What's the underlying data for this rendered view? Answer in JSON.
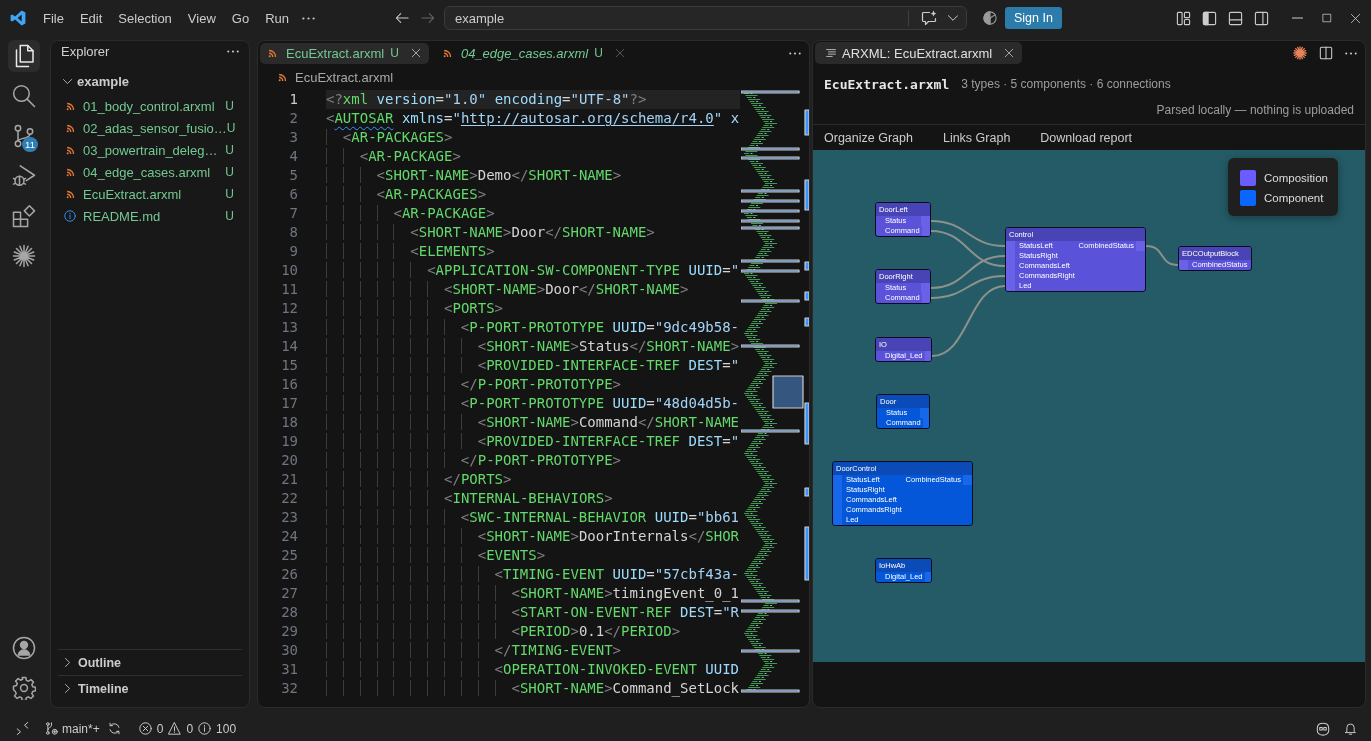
{
  "titlebar": {
    "menu": [
      "File",
      "Edit",
      "Selection",
      "View",
      "Go",
      "Run"
    ],
    "back": {
      "disabled": false
    },
    "forward": {
      "disabled": true
    },
    "command_center": {
      "label": "example"
    },
    "sign_in": "Sign In",
    "layout_buttons": [
      {
        "kind": "customize",
        "on": false
      },
      {
        "kind": "sidebar",
        "on": true
      },
      {
        "kind": "panel",
        "on": false
      },
      {
        "kind": "secondary",
        "on": false
      }
    ]
  },
  "activity_bar": {
    "items": [
      {
        "kind": "explorer",
        "selected": true
      },
      {
        "kind": "search",
        "selected": false
      },
      {
        "kind": "source-control",
        "selected": false,
        "badge": "11"
      },
      {
        "kind": "run-debug",
        "selected": false
      },
      {
        "kind": "extensions",
        "selected": false
      },
      {
        "kind": "sparkle",
        "selected": false
      }
    ],
    "bottom": [
      {
        "kind": "account"
      },
      {
        "kind": "settings"
      }
    ]
  },
  "explorer": {
    "title": "Explorer",
    "folder": {
      "label": "example",
      "expanded": true,
      "children": [
        {
          "label": "01_body_control.arxml",
          "kind": "xml",
          "status": "U"
        },
        {
          "label": "02_adas_sensor_fusio…",
          "kind": "xml",
          "status": "U"
        },
        {
          "label": "03_powertrain_deleg…",
          "kind": "xml",
          "status": "U"
        },
        {
          "label": "04_edge_cases.arxml",
          "kind": "xml",
          "status": "U"
        },
        {
          "label": "EcuExtract.arxml",
          "kind": "xml",
          "status": "U"
        },
        {
          "label": "README.md",
          "kind": "markdown",
          "status": "U"
        }
      ]
    },
    "sections": [
      {
        "label": "Outline",
        "expanded": false
      },
      {
        "label": "Timeline",
        "expanded": false
      }
    ]
  },
  "editor": {
    "tabs": [
      {
        "label": "EcuExtract.arxml",
        "kind": "xml",
        "status": "U",
        "selected": true,
        "preview": false
      },
      {
        "label": "04_edge_cases.arxml",
        "kind": "xml",
        "status": "U",
        "selected": false,
        "preview": true
      }
    ],
    "breadcrumb": [
      {
        "label": "EcuExtract.arxml",
        "kind": "xml"
      }
    ],
    "lines": [
      {
        "number": "1",
        "text": "<?xml version=\"1.0\" encoding=\"UTF-8\"?>",
        "current": true,
        "warning": false,
        "link": false
      },
      {
        "number": "2",
        "text": "<AUTOSAR xmlns=\"http://autosar.org/schema/r4.0\" x",
        "current": false,
        "warning": true,
        "link": true
      },
      {
        "number": "3",
        "text": "  <AR-PACKAGES>",
        "current": false,
        "warning": false,
        "link": false
      },
      {
        "number": "4",
        "text": "    <AR-PACKAGE>",
        "current": false,
        "warning": false,
        "link": false
      },
      {
        "number": "5",
        "text": "      <SHORT-NAME>Demo</SHORT-NAME>",
        "current": false,
        "warning": false,
        "link": false
      },
      {
        "number": "6",
        "text": "      <AR-PACKAGES>",
        "current": false,
        "warning": false,
        "link": false
      },
      {
        "number": "7",
        "text": "        <AR-PACKAGE>",
        "current": false,
        "warning": false,
        "link": false
      },
      {
        "number": "8",
        "text": "          <SHORT-NAME>Door</SHORT-NAME>",
        "current": false,
        "warning": false,
        "link": false
      },
      {
        "number": "9",
        "text": "          <ELEMENTS>",
        "current": false,
        "warning": false,
        "link": false
      },
      {
        "number": "10",
        "text": "            <APPLICATION-SW-COMPONENT-TYPE UUID=\"",
        "current": false,
        "warning": false,
        "link": false
      },
      {
        "number": "11",
        "text": "              <SHORT-NAME>Door</SHORT-NAME>",
        "current": false,
        "warning": false,
        "link": false
      },
      {
        "number": "12",
        "text": "              <PORTS>",
        "current": false,
        "warning": false,
        "link": false
      },
      {
        "number": "13",
        "text": "                <P-PORT-PROTOTYPE UUID=\"9dc49b58-",
        "current": false,
        "warning": false,
        "link": false
      },
      {
        "number": "14",
        "text": "                  <SHORT-NAME>Status</SHORT-NAME>",
        "current": false,
        "warning": false,
        "link": false
      },
      {
        "number": "15",
        "text": "                  <PROVIDED-INTERFACE-TREF DEST=\"",
        "current": false,
        "warning": false,
        "link": false
      },
      {
        "number": "16",
        "text": "                </P-PORT-PROTOTYPE>",
        "current": false,
        "warning": false,
        "link": false
      },
      {
        "number": "17",
        "text": "                <P-PORT-PROTOTYPE UUID=\"48d04d5b-",
        "current": false,
        "warning": false,
        "link": false
      },
      {
        "number": "18",
        "text": "                  <SHORT-NAME>Command</SHORT-NAME",
        "current": false,
        "warning": false,
        "link": false
      },
      {
        "number": "19",
        "text": "                  <PROVIDED-INTERFACE-TREF DEST=\"",
        "current": false,
        "warning": false,
        "link": false
      },
      {
        "number": "20",
        "text": "                </P-PORT-PROTOTYPE>",
        "current": false,
        "warning": false,
        "link": false
      },
      {
        "number": "21",
        "text": "              </PORTS>",
        "current": false,
        "warning": false,
        "link": false
      },
      {
        "number": "22",
        "text": "              <INTERNAL-BEHAVIORS>",
        "current": false,
        "warning": false,
        "link": false
      },
      {
        "number": "23",
        "text": "                <SWC-INTERNAL-BEHAVIOR UUID=\"bb61",
        "current": false,
        "warning": false,
        "link": false
      },
      {
        "number": "24",
        "text": "                  <SHORT-NAME>DoorInternals</SHOR",
        "current": false,
        "warning": false,
        "link": false
      },
      {
        "number": "25",
        "text": "                  <EVENTS>",
        "current": false,
        "warning": false,
        "link": false
      },
      {
        "number": "26",
        "text": "                    <TIMING-EVENT UUID=\"57cbf43a-",
        "current": false,
        "warning": false,
        "link": false
      },
      {
        "number": "27",
        "text": "                      <SHORT-NAME>timingEvent_0_1",
        "current": false,
        "warning": false,
        "link": false
      },
      {
        "number": "28",
        "text": "                      <START-ON-EVENT-REF DEST=\"R",
        "current": false,
        "warning": false,
        "link": false
      },
      {
        "number": "29",
        "text": "                      <PERIOD>0.1</PERIOD>",
        "current": false,
        "warning": false,
        "link": false
      },
      {
        "number": "30",
        "text": "                    </TIMING-EVENT>",
        "current": false,
        "warning": false,
        "link": false
      },
      {
        "number": "31",
        "text": "                    <OPERATION-INVOKED-EVENT UUID",
        "current": false,
        "warning": false,
        "link": false
      },
      {
        "number": "32",
        "text": "                      <SHORT-NAME>Command_SetLock",
        "current": false,
        "warning": false,
        "link": false
      }
    ]
  },
  "viewer": {
    "tab": {
      "label": "ARXML: EcuExtract.arxml",
      "selected": true
    },
    "title": "EcuExtract.arxml",
    "summary": "3 types · 5 components · 6 connections",
    "note": "Parsed locally — nothing is uploaded",
    "actions": [
      "Organize Graph",
      "Links Graph",
      "Download report"
    ],
    "graph": {
      "legend": [
        {
          "label": "Composition",
          "color": "#6b5cff"
        },
        {
          "label": "Component",
          "color": "#0a66ff"
        }
      ],
      "nodes": [
        {
          "title": "DoorLeft",
          "kind": "composition",
          "outputs": [
            "Status",
            "Command"
          ]
        },
        {
          "title": "DoorRight",
          "kind": "composition",
          "outputs": [
            "Status",
            "Command"
          ]
        },
        {
          "title": "Control",
          "kind": "composition",
          "inputs": [
            "StatusLeft",
            "StatusRight",
            "CommandsLeft",
            "CommandsRight",
            "Led"
          ],
          "outputs": [
            "CombinedStatus"
          ]
        },
        {
          "title": "EDCOutputBlock",
          "kind": "composition",
          "inputs": [
            "CombinedStatus"
          ]
        },
        {
          "title": "IO",
          "kind": "composition",
          "outputs": [
            "Digital_Led"
          ]
        },
        {
          "title": "Door",
          "kind": "component",
          "outputs": [
            "Status",
            "Command"
          ]
        },
        {
          "title": "DoorControl",
          "kind": "component",
          "inputs": [
            "StatusLeft",
            "StatusRight",
            "CommandsLeft",
            "CommandsRight",
            "Led"
          ],
          "outputs": [
            "CombinedStatus"
          ]
        },
        {
          "title": "IoHwAb",
          "kind": "component",
          "outputs": [
            "Digital_Led"
          ]
        }
      ]
    }
  },
  "status_bar": {
    "branch": "main*+",
    "errors": "0",
    "warnings": "0",
    "infos": "100"
  }
}
